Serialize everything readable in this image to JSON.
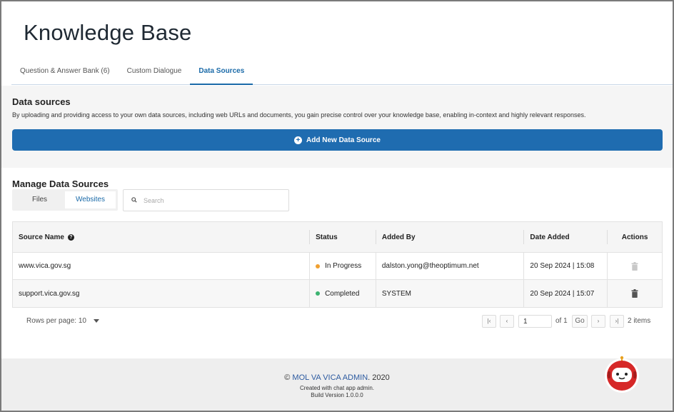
{
  "page": {
    "title": "Knowledge Base"
  },
  "tabs": [
    {
      "label": "Question & Answer Bank (6)",
      "active": false
    },
    {
      "label": "Custom Dialogue",
      "active": false
    },
    {
      "label": "Data Sources",
      "active": true
    }
  ],
  "data_sources": {
    "title": "Data sources",
    "description": "By uploading and providing access to your own data sources, including web URLs and documents, you gain precise control over your knowledge base, enabling in-context and highly relevant responses.",
    "add_button_label": "Add New Data Source",
    "add_icon": "plus-circle-icon",
    "accent_color": "#1f6cb0"
  },
  "manage": {
    "title": "Manage Data Sources",
    "toggle": {
      "files_label": "Files",
      "websites_label": "Websites",
      "selected": "Websites"
    },
    "search": {
      "placeholder": "Search",
      "value": ""
    }
  },
  "table": {
    "headers": {
      "source_name": "Source Name",
      "status": "Status",
      "added_by": "Added By",
      "date_added": "Date Added",
      "actions": "Actions"
    },
    "rows": [
      {
        "source_name": "www.vica.gov.sg",
        "status": "In Progress",
        "status_color": "#f0a030",
        "added_by": "dalston.yong@theoptimum.net",
        "date_added": "20 Sep 2024 | 15:08",
        "delete_enabled": false
      },
      {
        "source_name": "support.vica.gov.sg",
        "status": "Completed",
        "status_color": "#3cb371",
        "added_by": "SYSTEM",
        "date_added": "20 Sep 2024 | 15:07",
        "delete_enabled": true
      }
    ]
  },
  "pagination": {
    "rows_per_page_label": "Rows per page:",
    "rows_per_page_value": "10",
    "first_icon": "first-page-icon",
    "prev_icon": "prev-page-icon",
    "page_value": "1",
    "of_label": "of 1",
    "go_label": "Go",
    "next_icon": "next-page-icon",
    "last_icon": "last-page-icon",
    "items_label": "2 items"
  },
  "footer": {
    "copyright_symbol": "©",
    "brand": "MOL VA VICA ADMIN",
    "year": ". 2020",
    "created_with": "Created with chat app admin.",
    "build_version": "Build Version 1.0.0.0"
  },
  "chat_bot": {
    "icon": "robot-avatar-icon",
    "color": "#d62828"
  }
}
